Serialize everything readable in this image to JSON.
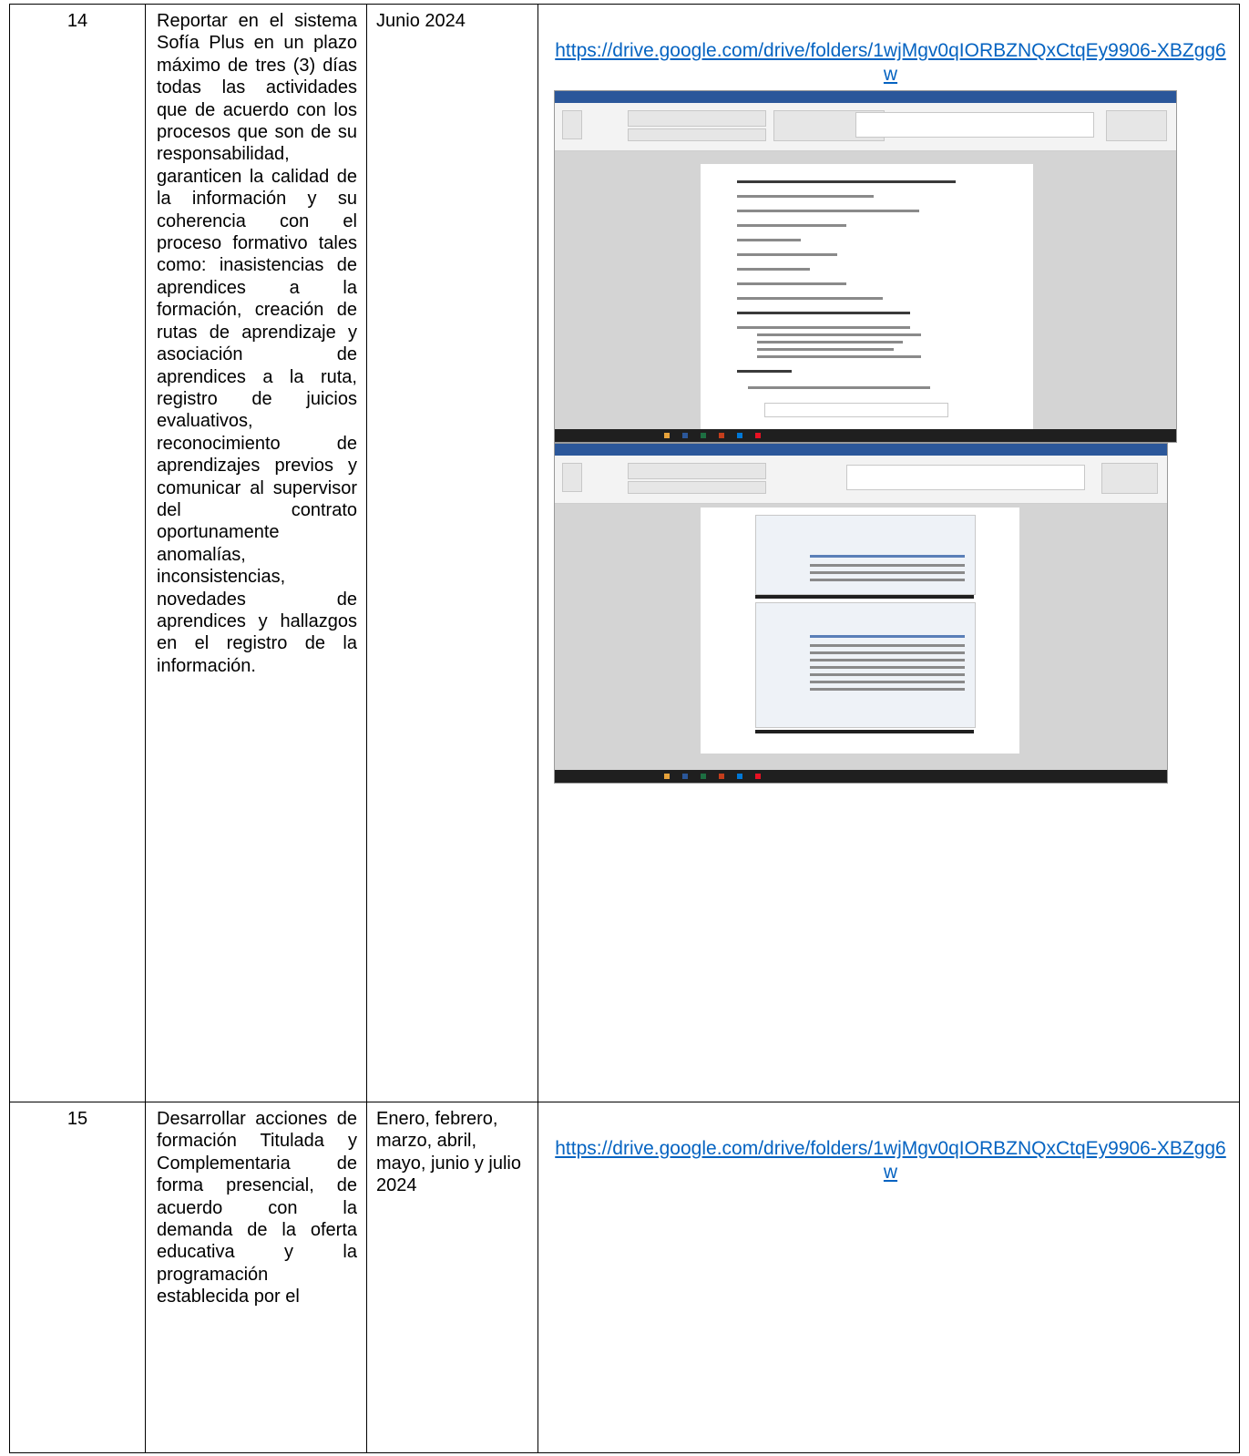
{
  "rows": [
    {
      "number": "14",
      "activity": "Reportar en el sistema Sofía Plus en un plazo máximo de tres (3) días todas las actividades que de acuerdo con los procesos que son de su responsabilidad, garanticen la calidad de la información y su coherencia con el proceso formativo tales como: inasistencias de aprendices a la formación, creación de rutas de aprendizaje y asociación de aprendices a la ruta, registro de juicios evaluativos, reconocimiento de aprendizajes previos y comunicar al supervisor del contrato oportunamente anomalías, inconsistencias, novedades de aprendices y hallazgos en el registro de la información.",
      "date": "Junio 2024",
      "link": "https://drive.google.com/drive/folders/1wjMgv0qIORBZNQxCtqEy9906-XBZgg6w"
    },
    {
      "number": "15",
      "activity": "Desarrollar acciones de formación Titulada y Complementaria de forma presencial, de acuerdo con la demanda de la oferta educativa y la programación establecida por el",
      "date": "Enero, febrero, marzo, abril, mayo, junio y julio 2024",
      "link": "https://drive.google.com/drive/folders/1wjMgv0qIORBZNQxCtqEy9906-XBZgg6w"
    }
  ],
  "colors": {
    "link": "#0563c1",
    "word_titlebar": "#2b579a",
    "taskbar": "#1f1f1f"
  }
}
